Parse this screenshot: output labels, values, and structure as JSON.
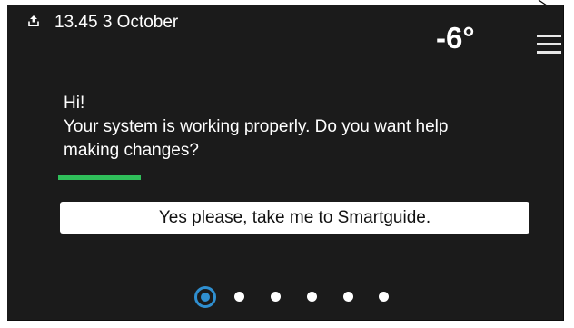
{
  "status_bar": {
    "icon": "upload-arrow-icon",
    "datetime": "13.45 3 October",
    "temperature": "-6°",
    "menu_icon": "hamburger-menu-icon"
  },
  "message": {
    "greeting": "Hi!",
    "line1": "Your system is working properly. Do you want help",
    "line2": "making changes?"
  },
  "colors": {
    "background": "#1b1b1b",
    "accent_green": "#2fbf5a",
    "active_dot_blue": "#2f8fd0"
  },
  "actions": {
    "smartguide_button": "Yes please, take me to Smartguide."
  },
  "pager": {
    "page_count": 6,
    "active_page": 1
  }
}
